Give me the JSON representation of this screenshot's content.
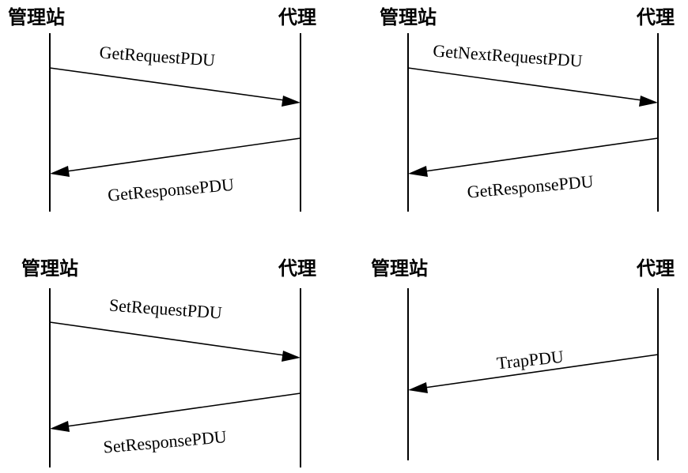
{
  "roles": {
    "manager": "管理站",
    "agent": "代理"
  },
  "diagrams": [
    {
      "messages": [
        {
          "label": "GetRequestPDU",
          "direction": "manager-to-agent"
        },
        {
          "label": "GetResponsePDU",
          "direction": "agent-to-manager"
        }
      ]
    },
    {
      "messages": [
        {
          "label": "GetNextRequestPDU",
          "direction": "manager-to-agent"
        },
        {
          "label": "GetResponsePDU",
          "direction": "agent-to-manager"
        }
      ]
    },
    {
      "messages": [
        {
          "label": "SetRequestPDU",
          "direction": "manager-to-agent"
        },
        {
          "label": "SetResponsePDU",
          "direction": "agent-to-manager"
        }
      ]
    },
    {
      "messages": [
        {
          "label": "TrapPDU",
          "direction": "agent-to-manager"
        }
      ]
    }
  ],
  "colors": {
    "line": "#000000",
    "background": "#ffffff"
  }
}
